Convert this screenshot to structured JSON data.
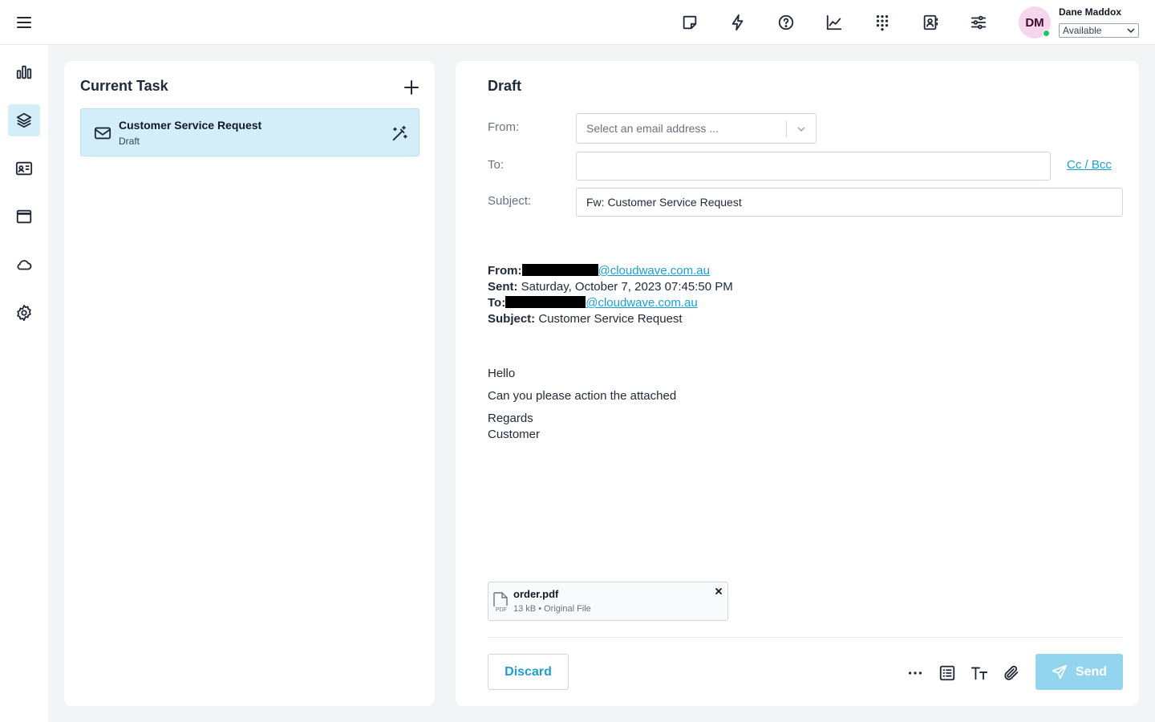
{
  "user": {
    "initials": "DM",
    "name": "Dane Maddox",
    "status": "Available",
    "status_color": "#22c55e"
  },
  "top_icons": [
    "note-icon",
    "bolt-icon",
    "help-icon",
    "chart-line-icon",
    "dialpad-icon",
    "contact-book-icon",
    "sliders-icon"
  ],
  "rail": {
    "items": [
      {
        "icon": "bar-chart-icon",
        "active": false
      },
      {
        "icon": "layers-icon",
        "active": true
      },
      {
        "icon": "id-card-icon",
        "active": false
      },
      {
        "icon": "window-icon",
        "active": false
      },
      {
        "icon": "cloud-icon",
        "active": false
      },
      {
        "icon": "gear-icon",
        "active": false
      }
    ]
  },
  "task_panel": {
    "title": "Current Task",
    "task": {
      "title": "Customer Service Request",
      "status": "Draft"
    }
  },
  "draft": {
    "title": "Draft",
    "from_label": "From:",
    "from_placeholder": "Select an email address ...",
    "to_label": "To:",
    "to_value": "",
    "cc_bcc": "Cc / Bcc",
    "subject_label": "Subject:",
    "subject_value": "Fw: Customer Service Request",
    "quoted": {
      "from_label": "From:",
      "from_domain": "@cloudwave.com.au",
      "sent_label": "Sent:",
      "sent_value": "Saturday, October 7, 2023 07:45:50 PM",
      "to_label": "To:",
      "to_domain": "@cloudwave.com.au",
      "subject_label": "Subject:",
      "subject_value": "Customer Service Request"
    },
    "body": {
      "greeting": "Hello",
      "line1": "Can you please action the attached",
      "closing": "Regards",
      "signature": "Customer"
    },
    "attachment": {
      "name": "order.pdf",
      "size": "13 kB",
      "type": "Original File",
      "badge": "PDF"
    },
    "discard_label": "Discard",
    "send_label": "Send",
    "accent_color": "#1a9fd0",
    "send_color": "#93d5ef"
  }
}
